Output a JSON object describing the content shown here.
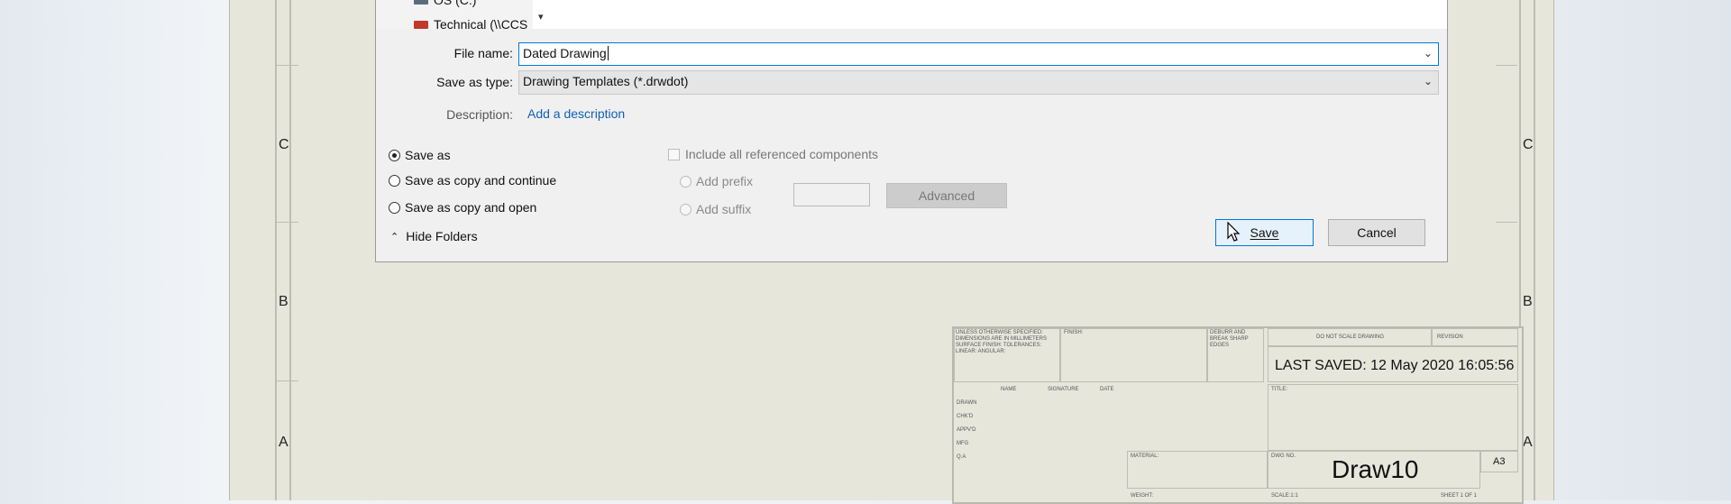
{
  "folder_tree": {
    "items": [
      {
        "label": "OS (C:)",
        "icon": "drive-icon"
      },
      {
        "label": "Technical (\\\\CCS",
        "icon": "network-drive-icon"
      }
    ]
  },
  "dialog": {
    "file_name_label": "File name:",
    "file_name_value": "Dated Drawing",
    "save_type_label": "Save as type:",
    "save_type_value": "Drawing Templates (*.drwdot)",
    "description_label": "Description:",
    "description_link": "Add a description",
    "radios": [
      {
        "label": "Save as",
        "selected": true
      },
      {
        "label": "Save as copy and continue",
        "selected": false
      },
      {
        "label": "Save as copy and open",
        "selected": false
      }
    ],
    "include_components": "Include all referenced components",
    "add_prefix": "Add prefix",
    "add_suffix": "Add suffix",
    "advanced": "Advanced",
    "hide_folders": "Hide Folders",
    "save": "Save",
    "cancel": "Cancel"
  },
  "sheet": {
    "zones": [
      "C",
      "B",
      "A"
    ],
    "title_block": {
      "tolerance_note": "UNLESS OTHERWISE SPECIFIED: DIMENSIONS ARE IN MILLIMETERS SURFACE FINISH: TOLERANCES: LINEAR: ANGULAR:",
      "finish": "FINISH:",
      "deburr": "DEBURR AND BREAK SHARP EDGES",
      "do_not_scale": "DO NOT SCALE DRAWING",
      "revision": "REVISION",
      "last_saved": "LAST SAVED: 12 May 2020 16:05:56",
      "headers": [
        "NAME",
        "SIGNATURE",
        "DATE"
      ],
      "rows": [
        "DRAWN",
        "CHK'D",
        "APPV'D",
        "MFG",
        "Q.A"
      ],
      "title_label": "TITLE:",
      "material_label": "MATERIAL:",
      "dwg_no_label": "DWG NO.",
      "drawing_name": "Draw10",
      "sheet_size": "A3",
      "weight_label": "WEIGHT:",
      "scale_label": "SCALE:1:1",
      "sheet_label": "SHEET 1 OF 1"
    }
  },
  "colors": {
    "accent": "#0078d7",
    "link": "#1060b5",
    "sheet": "#e7e6db"
  }
}
